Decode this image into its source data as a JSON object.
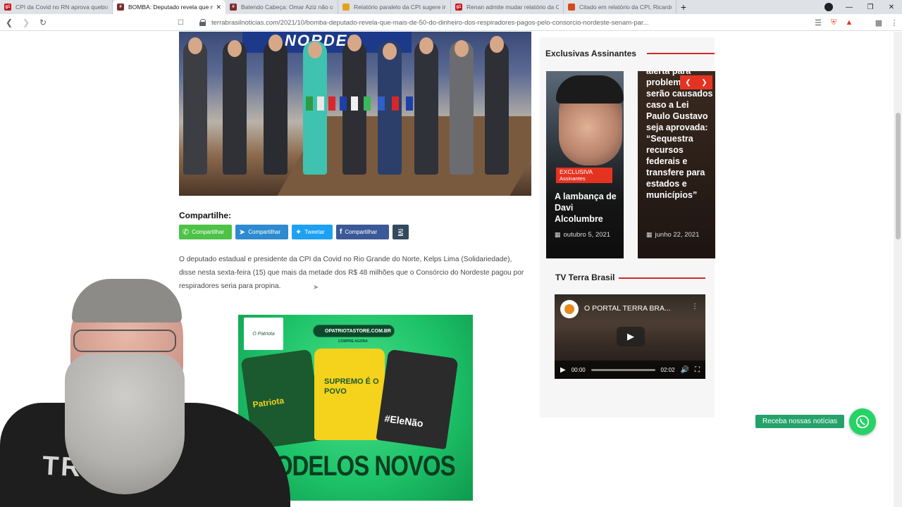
{
  "browser": {
    "tabs": [
      {
        "title": "CPI da Covid no RN aprova quebra de",
        "fav_color": "#c4161c",
        "fav_text": "g1",
        "active": false
      },
      {
        "title": "BOMBA: Deputado revela que ma",
        "fav_color": "#7a2e2e",
        "fav_text": "#",
        "active": true
      },
      {
        "title": "Batendo Cabeça: Omar Aziz não conse",
        "fav_color": "#7a2e2e",
        "fav_text": "#",
        "active": false
      },
      {
        "title": "Relatório paralelo da CPI sugere indic",
        "fav_color": "#e3a21a",
        "fav_text": "",
        "active": false
      },
      {
        "title": "Renan admite mudar relatório da CPI",
        "fav_color": "#c4161c",
        "fav_text": "g1",
        "active": false
      },
      {
        "title": "Citado em relatório da CPI, Ricardo Ba",
        "fav_color": "#d9481c",
        "fav_text": "",
        "active": false
      }
    ],
    "url": "terrabrasilnoticias.com/2021/10/bomba-deputado-revela-que-mais-de-50-do-dinheiro-dos-respiradores-pagos-pelo-consorcio-nordeste-senam-par..."
  },
  "hero": {
    "banner": "NORDES"
  },
  "share": {
    "title": "Compartilhe:",
    "whatsapp": "Compartilhar",
    "telegram": "Compartilhar",
    "twitter": "Tweetar",
    "facebook": "Compartilhar"
  },
  "article": {
    "paragraph": "O deputado estadual e presidente da CPI da Covid no Rio Grande do Norte, Kelps Lima (Solidariedade), disse nesta sexta-feira (15) que mais da metade dos R$ 48 milhões que o Consórcio do Nordeste pagou por respiradores seria para propina."
  },
  "ad": {
    "logo": "O Patriota",
    "site": "OPATRIOTASTORE.COM.BR",
    "compre": "COMPRE AGORA",
    "shirt1": "Patriota",
    "shirt2": "SUPREMO É O POVO",
    "shirt3": "#EleNão",
    "headline": "MODELOS NOVOS"
  },
  "sidebar": {
    "exclusive_title": "Exclusivas Assinantes",
    "cards": [
      {
        "badge": "EXCLUSIVA",
        "badge_sub": "Assinantes",
        "title": "A lambança de Davi Alcolumbre",
        "date": "outubro 5, 2021"
      },
      {
        "title": "alerta para problemas que serão causados caso a Lei Paulo Gustavo seja aprovada: “Sequestra recursos federais e transfere para estados e municípios”",
        "date": "junho 22, 2021"
      }
    ],
    "tv_title": "TV Terra Brasil",
    "video": {
      "title": "O PORTAL TERRA BRA...",
      "time_current": "00:00",
      "time_total": "02:02"
    }
  },
  "whatsapp_widget": {
    "label": "Receba nossas notícias"
  },
  "webcam": {
    "shirt_text": "TRIMOR"
  },
  "colors": {
    "accent": "#d9262a",
    "whatsapp": "#25d366",
    "telegram": "#2f8bd0",
    "twitter": "#1da1f2",
    "facebook": "#3b5998"
  }
}
